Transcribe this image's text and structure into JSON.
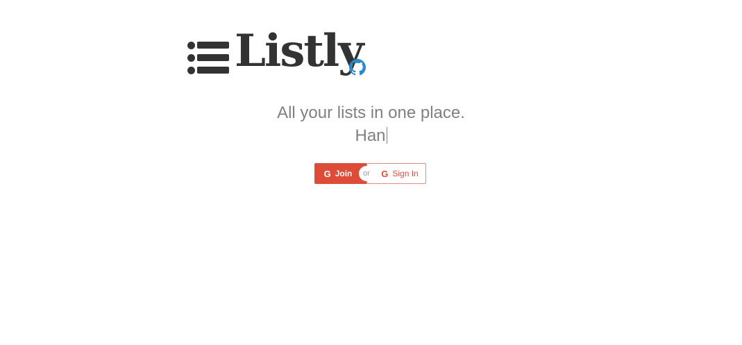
{
  "logo": {
    "wordmark": "Listly",
    "list_icon": "list-icon",
    "github_icon": "github-icon",
    "github_color": "#2b8acb"
  },
  "hero": {
    "tagline": "All your lists in one place.",
    "typed_text": "Han"
  },
  "auth": {
    "join_icon": "google-icon",
    "join_label": "Join",
    "divider_label": "or",
    "signin_icon": "google-icon",
    "signin_label": "Sign In",
    "accent_color": "#dd4b39"
  }
}
